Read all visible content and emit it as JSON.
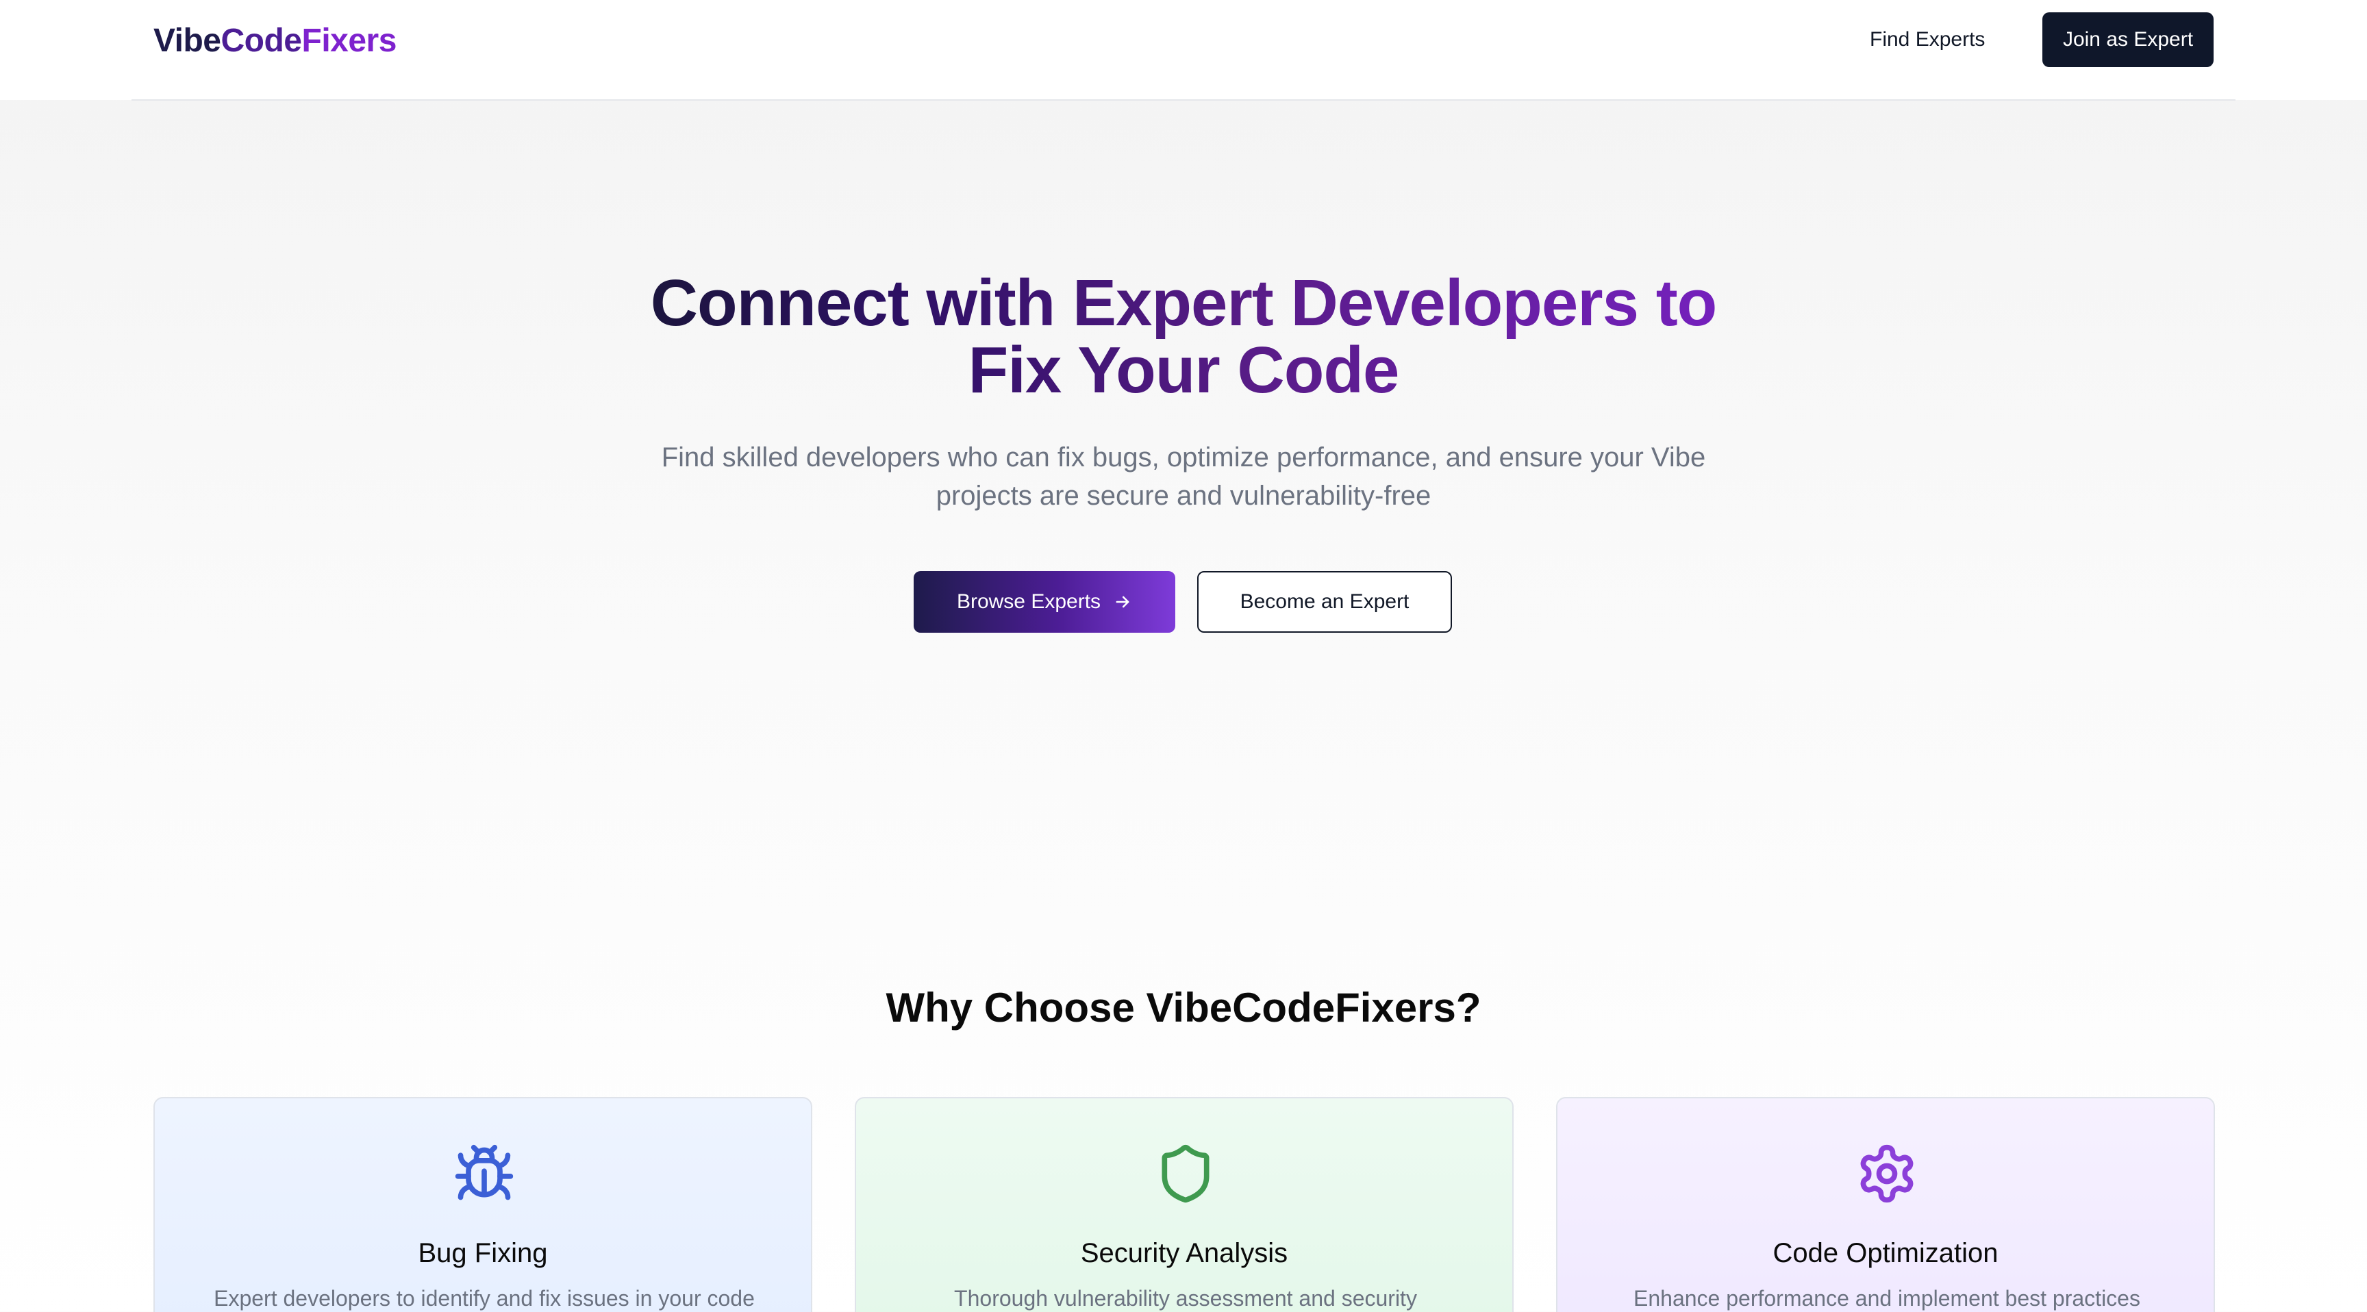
{
  "header": {
    "logo": {
      "part1": "Vibe",
      "part2": "Code",
      "part3": "Fixers"
    },
    "nav_find_experts": "Find Experts",
    "join_button": "Join as Expert"
  },
  "hero": {
    "title_line1": "Connect with Expert Developers to",
    "title_line2": "Fix Your Code",
    "subtitle_line1": "Find skilled developers who can fix bugs, optimize performance, and ensure your Vibe",
    "subtitle_line2": "projects are secure and vulnerability-free",
    "browse_button": "Browse Experts",
    "become_button": "Become an Expert"
  },
  "why": {
    "title": "Why Choose VibeCodeFixers?",
    "cards": [
      {
        "icon": "bug-icon",
        "color": "#3b5fd6",
        "title": "Bug Fixing",
        "description": "Expert developers to identify and fix issues in your code"
      },
      {
        "icon": "shield-icon",
        "color": "#3f9a4f",
        "title": "Security Analysis",
        "description": "Thorough vulnerability assessment and security"
      },
      {
        "icon": "gear-icon",
        "color": "#8b3fd9",
        "title": "Code Optimization",
        "description": "Enhance performance and implement best practices"
      }
    ]
  }
}
